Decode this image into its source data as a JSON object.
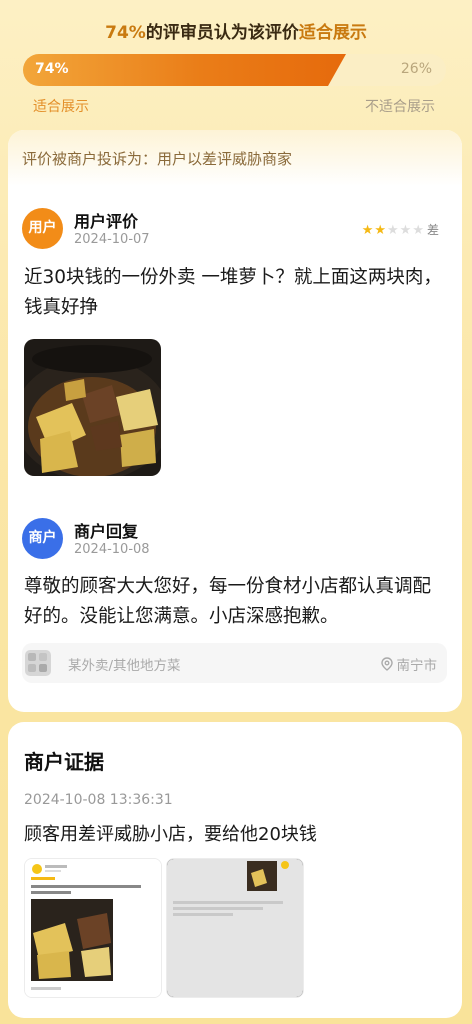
{
  "vote": {
    "title_pct": "74%",
    "title_mid": "的评审员认为该评价",
    "title_end": "适合展示",
    "left_pct": "74%",
    "right_pct": "26%",
    "fill_fraction": 0.74,
    "left_label": "适合展示",
    "right_label": "不适合展示"
  },
  "complaint": {
    "text": "评价被商户投诉为：用户以差评威胁商家"
  },
  "user_review": {
    "avatar": "用户",
    "name": "用户评价",
    "date": "2024-10-07",
    "rating": 2,
    "rating_max": 5,
    "rating_text": "差",
    "text": "近30块钱的一份外卖 一堆萝卜？就上面这两块肉，钱真好挣"
  },
  "merchant_reply": {
    "avatar": "商户",
    "name": "商户回复",
    "date": "2024-10-08",
    "text": "尊敬的顾客大大您好，每一份食材小店都认真调配好的。没能让您满意。小店深感抱歉。"
  },
  "shop": {
    "category": "某外卖/其他地方菜",
    "location": "南宁市",
    "location_icon": "location-pin-icon"
  },
  "evidence": {
    "title": "商户证据",
    "time": "2024-10-08 13:36:31",
    "text": "顾客用差评威胁小店，要给他20块钱"
  },
  "colors": {
    "accent": "#ea7d18",
    "merchant_blue": "#3a6fe8",
    "star": "#f5b915"
  }
}
